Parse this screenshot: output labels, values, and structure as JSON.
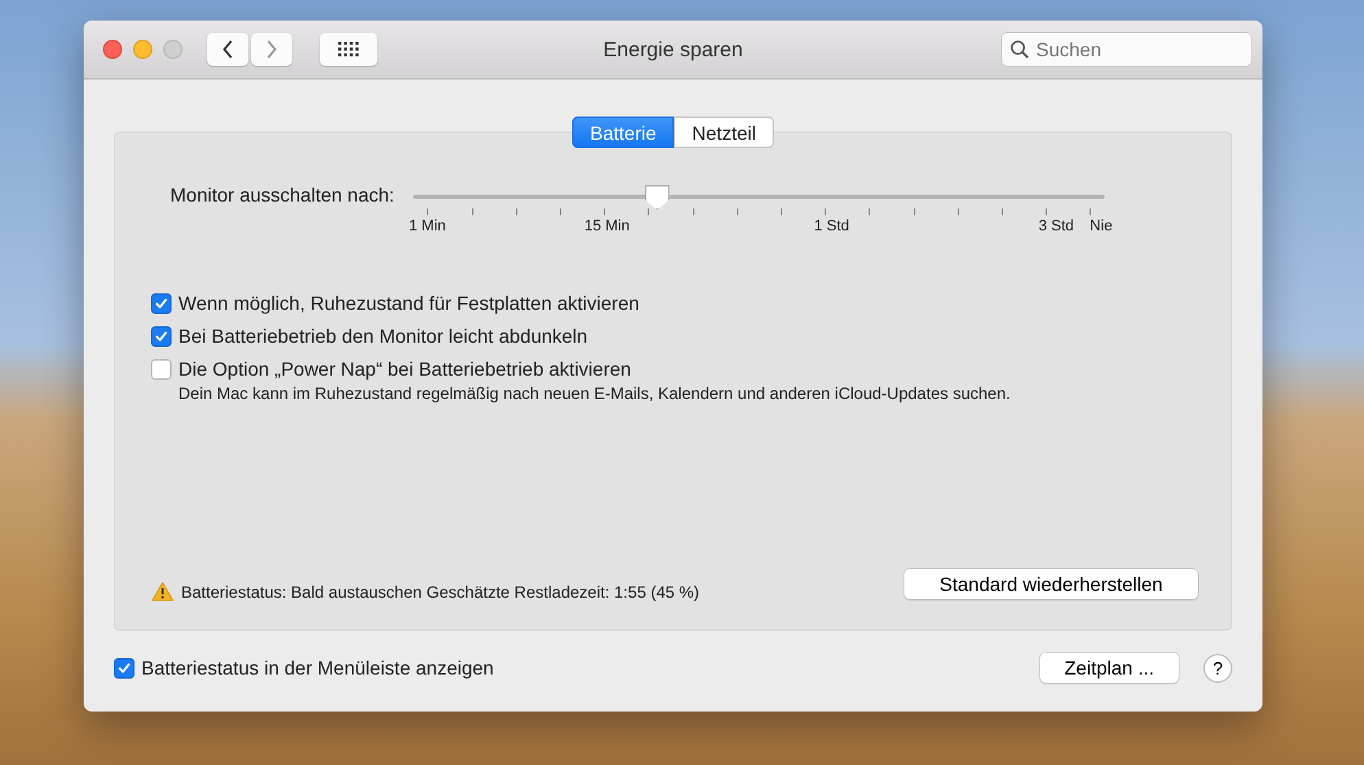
{
  "window": {
    "title": "Energie sparen"
  },
  "search": {
    "placeholder": "Suchen"
  },
  "tabs": [
    {
      "label": "Batterie",
      "selected": true
    },
    {
      "label": "Netzteil",
      "selected": false
    }
  ],
  "slider": {
    "label": "Monitor ausschalten nach:",
    "level": 0.35,
    "tick_labels": [
      "1 Min",
      "15 Min",
      "1 Std",
      "3 Std",
      "Nie"
    ]
  },
  "options": [
    {
      "label": "Wenn möglich, Ruhezustand für Festplatten aktivieren",
      "checked": true
    },
    {
      "label": "Bei Batteriebetrieb den Monitor leicht abdunkeln",
      "checked": true
    },
    {
      "label": "Die Option „Power Nap“ bei Batteriebetrieb aktivieren",
      "checked": false,
      "description": "Dein Mac kann im Ruhezustand regelmäßig nach neuen E-Mails, Kalendern und anderen iCloud-Updates suchen."
    }
  ],
  "battery_status": "Batteriestatus: Bald austauschen Geschätzte Restladezeit: 1:55 (45 %)",
  "restore_button": "Standard wiederherstellen",
  "menubar_option": {
    "label": "Batteriestatus in der Menüleiste anzeigen",
    "checked": true
  },
  "schedule_button": "Zeitplan ...",
  "help_button": "?"
}
